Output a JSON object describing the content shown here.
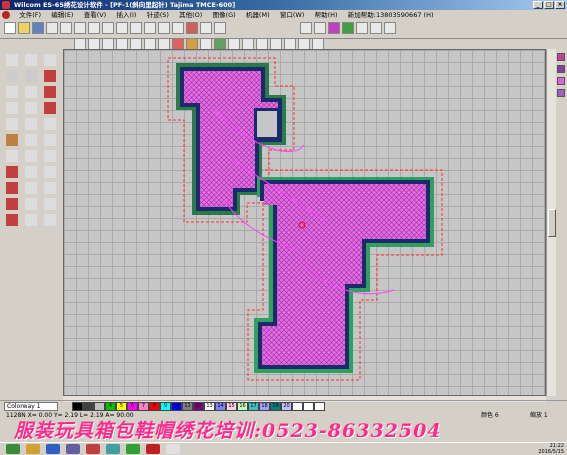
{
  "window": {
    "title": "Wilcom ES-65绣花设计软件 - [PF-1(斜向里起针) Tajima TMCE-600]"
  },
  "menu": [
    "文件(F)",
    "编辑(E)",
    "查看(V)",
    "插入(I)",
    "针迹(S)",
    "其他(O)",
    "图像(G)",
    "机器(M)",
    "窗口(W)",
    "帮助(H)",
    "新加帮助:13803590667 (H)"
  ],
  "colorway": {
    "selected": "Colorway 1"
  },
  "palette": {
    "swatches": [
      {
        "label": "",
        "color": "#000000"
      },
      {
        "label": "",
        "color": "#404040"
      },
      {
        "label": "",
        "color": "#c0c0c0"
      },
      {
        "label": "4",
        "color": "#00c000"
      },
      {
        "label": "5",
        "color": "#ffff00"
      },
      {
        "label": "6",
        "color": "#ff00ff"
      },
      {
        "label": "7",
        "color": "#ff80c0"
      },
      {
        "label": "8",
        "color": "#ff0000"
      },
      {
        "label": "9",
        "color": "#00ffff"
      },
      {
        "label": "10",
        "color": "#0000ff"
      },
      {
        "label": "11",
        "color": "#808080"
      },
      {
        "label": "12",
        "color": "#800080"
      },
      {
        "label": "13",
        "color": "#ffffff"
      },
      {
        "label": "14",
        "color": "#8080ff"
      },
      {
        "label": "15",
        "color": "#ffd0e0"
      },
      {
        "label": "16",
        "color": "#c0ffc0"
      },
      {
        "label": "17",
        "color": "#40c0c0"
      },
      {
        "label": "18",
        "color": "#a0a0ff"
      },
      {
        "label": "19",
        "color": "#008080"
      },
      {
        "label": "20",
        "color": "#c0c0ff"
      },
      {
        "label": "",
        "color": "#ffffff"
      },
      {
        "label": "",
        "color": "#ffffff"
      },
      {
        "label": "",
        "color": "#ffffff"
      }
    ]
  },
  "status": {
    "coords": "1128N  X=  0.00  Y=  2.19  L=  2.19  A=  90.00",
    "color_info": "颜色 6",
    "zoom_info": "缩放 1"
  },
  "banner": "服装玩具箱包鞋帽绣花培训:0523-86332504",
  "taskbar": {
    "time": "21:22",
    "date": "2016/5/15"
  },
  "design": {
    "letters": "PF",
    "fill_color": "#e060e0",
    "outline_colors": [
      "#2a7a4a",
      "#1a2a6a",
      "#30a060"
    ],
    "stitch_line_color": "#ff0000"
  }
}
